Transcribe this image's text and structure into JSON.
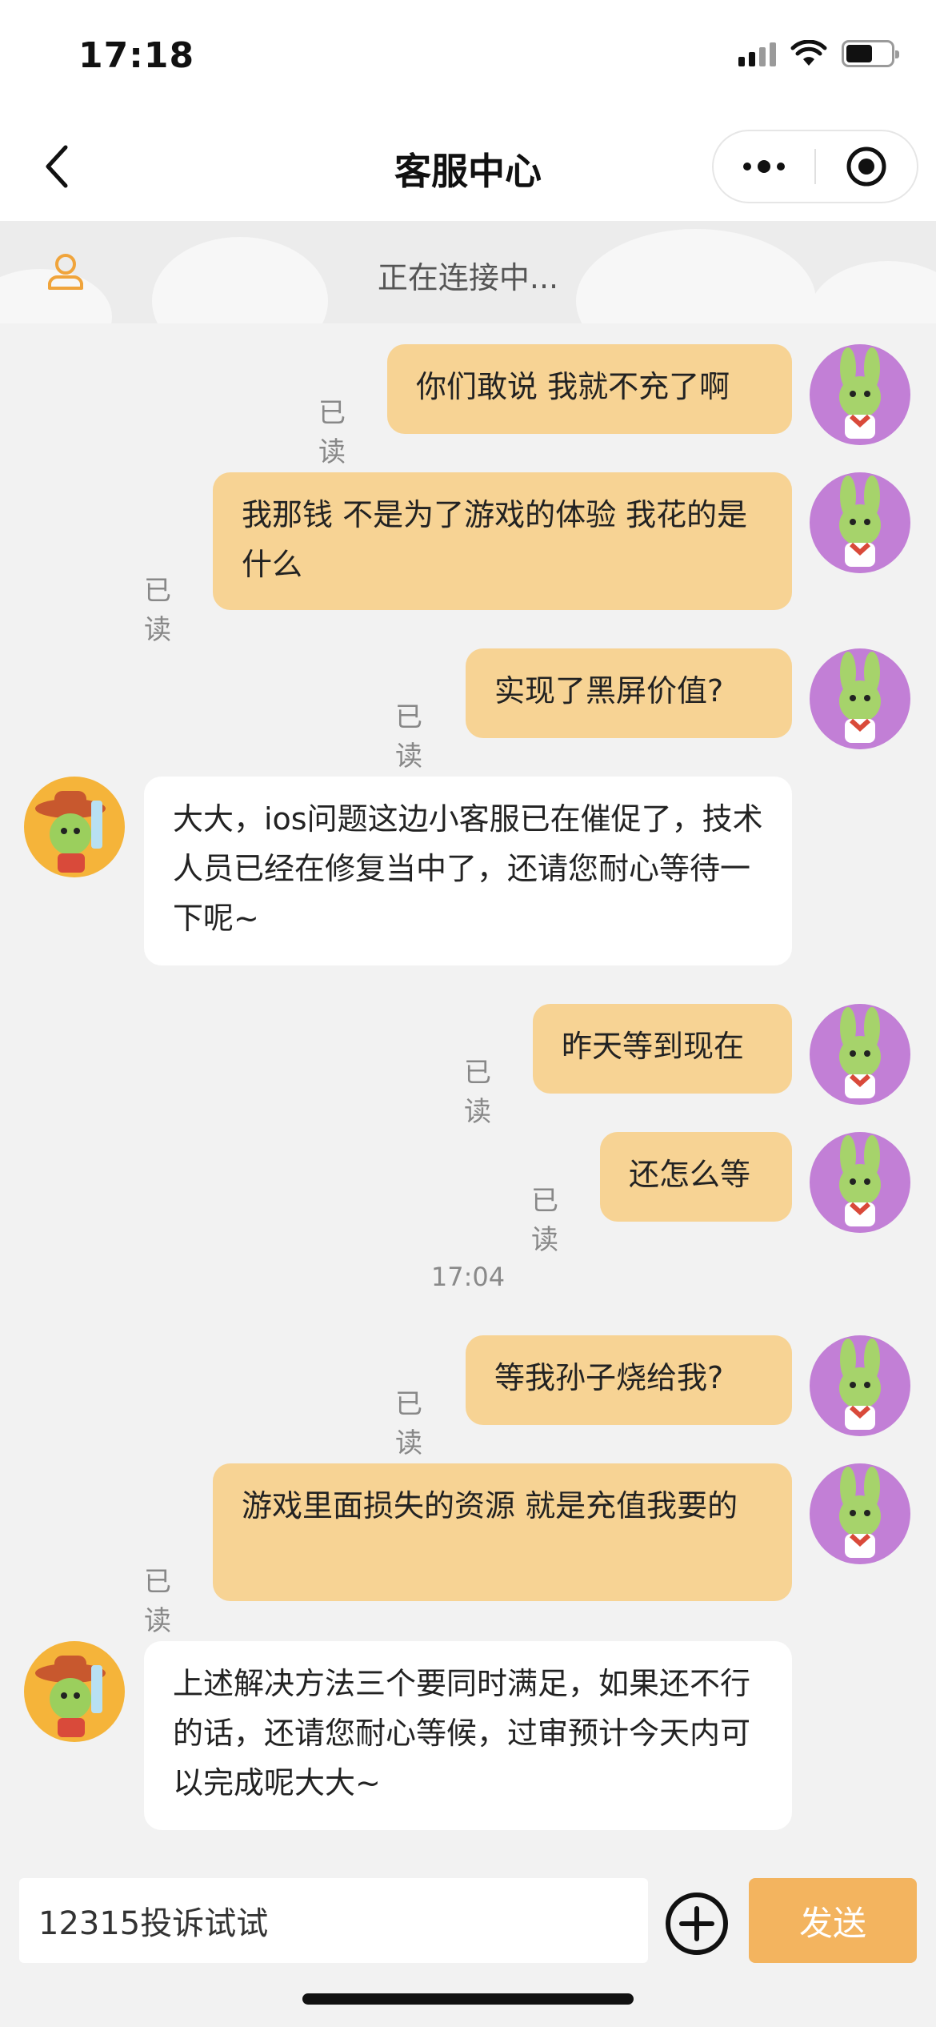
{
  "status_bar": {
    "time": "17:18"
  },
  "nav": {
    "title": "客服中心"
  },
  "banner": {
    "text": "正在连接中..."
  },
  "messages": [
    {
      "from": "me",
      "text": "你们敢说 我就不充了啊",
      "read": "已读"
    },
    {
      "from": "me",
      "text": "我那钱 不是为了游戏的体验 我花的是什么",
      "read": "已读"
    },
    {
      "from": "me",
      "text": "实现了黑屏价值?",
      "read": "已读"
    },
    {
      "from": "agent",
      "text": "大大，ios问题这边小客服已在催促了，技术人员已经在修复当中了，还请您耐心等待一下呢~"
    },
    {
      "from": "me",
      "text": "昨天等到现在",
      "read": "已读"
    },
    {
      "from": "me",
      "text": "还怎么等",
      "read": "已读"
    },
    {
      "from": "me",
      "text": "等我孙子烧给我?",
      "read": "已读"
    },
    {
      "from": "me",
      "text": "游戏里面损失的资源 就是充值我要的",
      "read": "已读"
    },
    {
      "from": "agent",
      "text": "上述解决方法三个要同时满足，如果还不行的话，还请您耐心等候，过审预计今天内可以完成呢大大~"
    }
  ],
  "time_separator": "17:04",
  "input": {
    "value": "12315投诉试试",
    "send_label": "发送"
  },
  "colors": {
    "my_bubble": "#f7d394",
    "send_button": "#f3b45f",
    "agent_bubble": "#ffffff"
  }
}
